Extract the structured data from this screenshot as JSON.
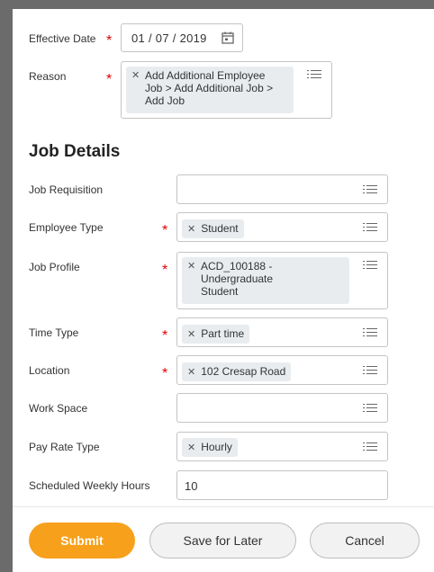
{
  "form": {
    "effective_date": {
      "label": "Effective Date",
      "value": "01 / 07 / 2019"
    },
    "reason": {
      "label": "Reason",
      "line1": "Add Additional Employee",
      "line2": "Job > Add Additional Job >",
      "line3": "Add Job"
    },
    "section_title": "Job Details",
    "job_requisition": {
      "label": "Job Requisition",
      "value": ""
    },
    "employee_type": {
      "label": "Employee Type",
      "value": "Student"
    },
    "job_profile": {
      "label": "Job Profile",
      "line1": "ACD_100188 -",
      "line2": "Undergraduate",
      "line3": "Student"
    },
    "time_type": {
      "label": "Time Type",
      "value": "Part time"
    },
    "location": {
      "label": "Location",
      "value": "102 Cresap Road"
    },
    "work_space": {
      "label": "Work Space",
      "value": ""
    },
    "pay_rate_type": {
      "label": "Pay Rate Type",
      "value": "Hourly"
    },
    "scheduled_weekly_hours": {
      "label": "Scheduled Weekly Hours",
      "value": "10"
    },
    "required_marker": "*",
    "remove_glyph": "✕"
  },
  "footer": {
    "submit_label": "Submit",
    "save_label": "Save for Later",
    "cancel_label": "Cancel"
  },
  "colors": {
    "submit": "#f7a01b",
    "required": "#e00000",
    "pill": "#e8ecef"
  },
  "icons": {
    "calendar": "calendar-icon",
    "prompt": "list-icon",
    "remove": "close-icon"
  }
}
